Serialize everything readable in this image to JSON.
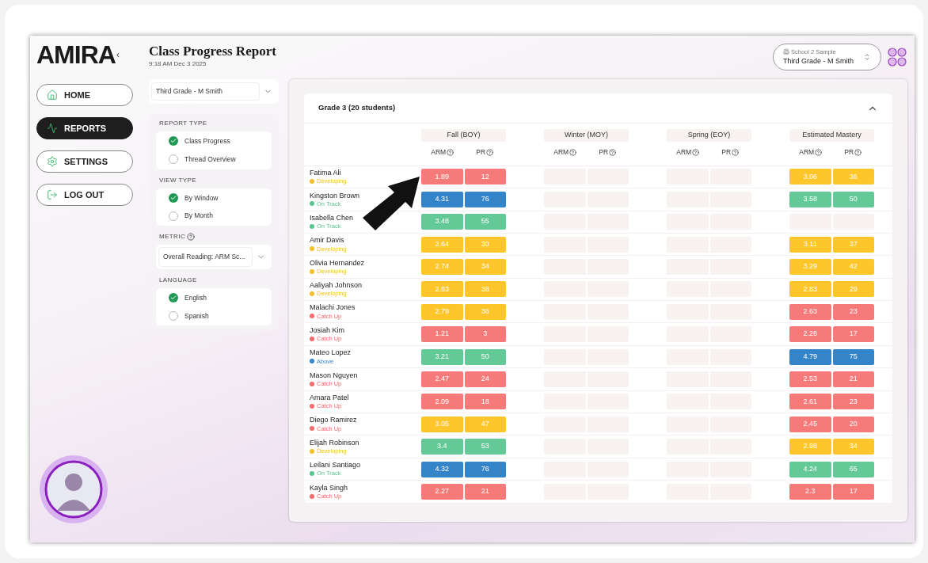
{
  "logo": "AMIRA",
  "collapse_glyph": "‹",
  "header": {
    "title": "Class Progress Report",
    "timestamp": "9:18 AM Dec 3 2025"
  },
  "school_picker": {
    "school": "School 2 Sample",
    "class": "Third Grade - M Smith"
  },
  "nav": [
    {
      "label": "HOME",
      "selected": false
    },
    {
      "label": "REPORTS",
      "selected": true
    },
    {
      "label": "SETTINGS",
      "selected": false
    },
    {
      "label": "LOG OUT",
      "selected": false
    }
  ],
  "class_select": {
    "value": "Third Grade - M Smith"
  },
  "filters": [
    {
      "kind": "radio",
      "title": "REPORT TYPE",
      "options": [
        {
          "label": "Class Progress",
          "selected": true
        },
        {
          "label": "Thread Overview",
          "selected": false
        }
      ]
    },
    {
      "kind": "radio",
      "title": "VIEW TYPE",
      "options": [
        {
          "label": "By Window",
          "selected": true
        },
        {
          "label": "By Month",
          "selected": false
        }
      ]
    },
    {
      "kind": "select",
      "title": "METRIC",
      "help": true,
      "value": "Overall Reading: ARM Sc..."
    },
    {
      "kind": "radio",
      "title": "LANGUAGE",
      "options": [
        {
          "label": "English",
          "selected": true
        },
        {
          "label": "Spanish",
          "selected": false
        }
      ]
    }
  ],
  "report": {
    "title": "Grade 3 (20 students)",
    "expanded": true,
    "periods": [
      {
        "title": "Fall (BOY)",
        "columns": [
          "ARM",
          "PR"
        ]
      },
      {
        "title": "Winter (MOY)",
        "columns": [
          "ARM",
          "PR"
        ]
      },
      {
        "title": "Spring (EOY)",
        "columns": [
          "ARM",
          "PR"
        ]
      },
      {
        "title": "Estimated Mastery",
        "columns": [
          "ARM",
          "PR"
        ]
      }
    ],
    "students": [
      {
        "name": "Fatima Ali",
        "status": "Developing",
        "color": "#f5c02a",
        "scores": [
          {
            "kind": "score",
            "arm": "1.89",
            "pr": "12",
            "color": "#f77a7a"
          },
          {
            "kind": "empty"
          },
          {
            "kind": "empty"
          },
          {
            "kind": "score",
            "arm": "3.06",
            "pr": "36",
            "color": "#ffc62b"
          }
        ]
      },
      {
        "name": "Kingston Brown",
        "status": "On Track",
        "color": "#5cc48f",
        "scores": [
          {
            "kind": "score",
            "arm": "4.31",
            "pr": "76",
            "color": "#3484c9"
          },
          {
            "kind": "empty"
          },
          {
            "kind": "empty"
          },
          {
            "kind": "score",
            "arm": "3.58",
            "pr": "50",
            "color": "#63c996"
          }
        ]
      },
      {
        "name": "Isabella Chen",
        "status": "On Track",
        "color": "#5cc48f",
        "scores": [
          {
            "kind": "score",
            "arm": "3.48",
            "pr": "55",
            "color": "#63c996"
          },
          {
            "kind": "empty"
          },
          {
            "kind": "empty"
          },
          {
            "kind": "empty"
          }
        ]
      },
      {
        "name": "Amir Davis",
        "status": "Developing",
        "color": "#f5c02a",
        "scores": [
          {
            "kind": "score",
            "arm": "2.64",
            "pr": "30",
            "color": "#ffc62b"
          },
          {
            "kind": "empty"
          },
          {
            "kind": "empty"
          },
          {
            "kind": "score",
            "arm": "3.11",
            "pr": "37",
            "color": "#ffc62b"
          }
        ]
      },
      {
        "name": "Olivia Hernandez",
        "status": "Developing",
        "color": "#f5c02a",
        "scores": [
          {
            "kind": "score",
            "arm": "2.74",
            "pr": "34",
            "color": "#ffc62b"
          },
          {
            "kind": "empty"
          },
          {
            "kind": "empty"
          },
          {
            "kind": "score",
            "arm": "3.29",
            "pr": "42",
            "color": "#ffc62b"
          }
        ]
      },
      {
        "name": "Aaliyah Johnson",
        "status": "Developing",
        "color": "#f5c02a",
        "scores": [
          {
            "kind": "score",
            "arm": "2.83",
            "pr": "38",
            "color": "#ffc62b"
          },
          {
            "kind": "empty"
          },
          {
            "kind": "empty"
          },
          {
            "kind": "score",
            "arm": "2.83",
            "pr": "29",
            "color": "#ffc62b"
          }
        ]
      },
      {
        "name": "Malachi Jones",
        "status": "Catch Up",
        "color": "#f46b6b",
        "scores": [
          {
            "kind": "score",
            "arm": "2.79",
            "pr": "36",
            "color": "#ffc62b"
          },
          {
            "kind": "empty"
          },
          {
            "kind": "empty"
          },
          {
            "kind": "score",
            "arm": "2.63",
            "pr": "23",
            "color": "#f77a7a"
          }
        ]
      },
      {
        "name": "Josiah Kim",
        "status": "Catch Up",
        "color": "#f46b6b",
        "scores": [
          {
            "kind": "score",
            "arm": "1.21",
            "pr": "3",
            "color": "#f77a7a"
          },
          {
            "kind": "empty"
          },
          {
            "kind": "empty"
          },
          {
            "kind": "score",
            "arm": "2.28",
            "pr": "17",
            "color": "#f77a7a"
          }
        ]
      },
      {
        "name": "Mateo Lopez",
        "status": "Above",
        "color": "#3484c9",
        "scores": [
          {
            "kind": "score",
            "arm": "3.21",
            "pr": "50",
            "color": "#63c996"
          },
          {
            "kind": "empty"
          },
          {
            "kind": "empty"
          },
          {
            "kind": "score",
            "arm": "4.79",
            "pr": "75",
            "color": "#3484c9"
          }
        ]
      },
      {
        "name": "Mason Nguyen",
        "status": "Catch Up",
        "color": "#f46b6b",
        "scores": [
          {
            "kind": "score",
            "arm": "2.47",
            "pr": "24",
            "color": "#f77a7a"
          },
          {
            "kind": "empty"
          },
          {
            "kind": "empty"
          },
          {
            "kind": "score",
            "arm": "2.53",
            "pr": "21",
            "color": "#f77a7a"
          }
        ]
      },
      {
        "name": "Amara Patel",
        "status": "Catch Up",
        "color": "#f46b6b",
        "scores": [
          {
            "kind": "score",
            "arm": "2.09",
            "pr": "18",
            "color": "#f77a7a"
          },
          {
            "kind": "empty"
          },
          {
            "kind": "empty"
          },
          {
            "kind": "score",
            "arm": "2.61",
            "pr": "23",
            "color": "#f77a7a"
          }
        ]
      },
      {
        "name": "Diego Ramirez",
        "status": "Catch Up",
        "color": "#f46b6b",
        "scores": [
          {
            "kind": "score",
            "arm": "3.05",
            "pr": "47",
            "color": "#ffc62b"
          },
          {
            "kind": "empty"
          },
          {
            "kind": "empty"
          },
          {
            "kind": "score",
            "arm": "2.45",
            "pr": "20",
            "color": "#f77a7a"
          }
        ]
      },
      {
        "name": "Elijah Robinson",
        "status": "Developing",
        "color": "#f5c02a",
        "scores": [
          {
            "kind": "score",
            "arm": "3.4",
            "pr": "53",
            "color": "#63c996"
          },
          {
            "kind": "empty"
          },
          {
            "kind": "empty"
          },
          {
            "kind": "score",
            "arm": "2.98",
            "pr": "34",
            "color": "#ffc62b"
          }
        ]
      },
      {
        "name": "Leilani Santiago",
        "status": "On Track",
        "color": "#5cc48f",
        "scores": [
          {
            "kind": "score",
            "arm": "4.32",
            "pr": "76",
            "color": "#3484c9"
          },
          {
            "kind": "empty"
          },
          {
            "kind": "empty"
          },
          {
            "kind": "score",
            "arm": "4.24",
            "pr": "65",
            "color": "#63c996"
          }
        ]
      },
      {
        "name": "Kayla Singh",
        "status": "Catch Up",
        "color": "#f46b6b",
        "scores": [
          {
            "kind": "score",
            "arm": "2.27",
            "pr": "21",
            "color": "#f77a7a"
          },
          {
            "kind": "empty"
          },
          {
            "kind": "empty"
          },
          {
            "kind": "score",
            "arm": "2.3",
            "pr": "17",
            "color": "#f77a7a"
          }
        ]
      }
    ]
  }
}
